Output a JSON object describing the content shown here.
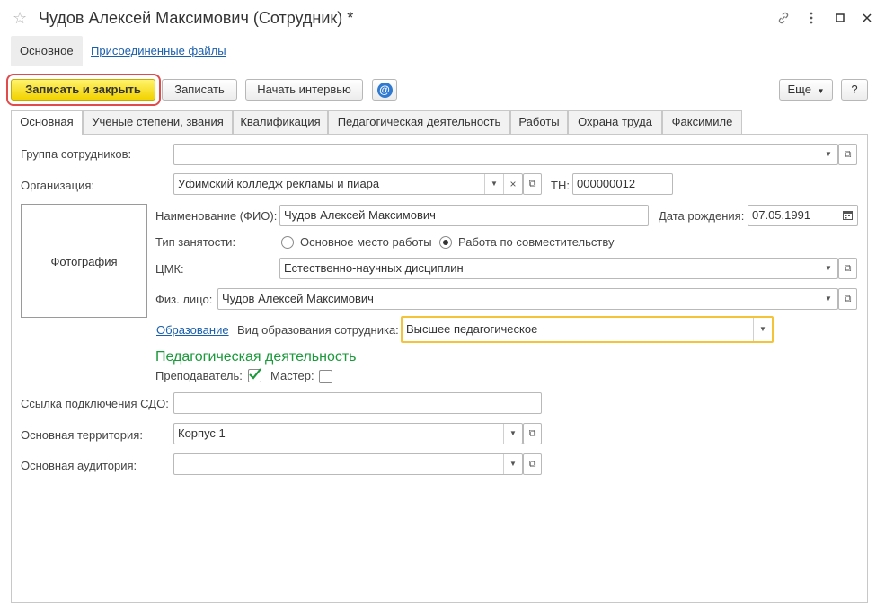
{
  "window": {
    "title": "Чудов Алексей Максимович (Сотрудник) *",
    "icons": {
      "favorite": "star-icon",
      "link": "link-icon",
      "menu": "more-vertical-icon",
      "maximize": "maximize-icon",
      "close": "close-icon"
    }
  },
  "nav": {
    "main": "Основное",
    "files": "Присоединенные файлы"
  },
  "toolbar": {
    "save_close": "Записать и закрыть",
    "save": "Записать",
    "interview": "Начать интервью",
    "mail_icon": "@",
    "more": "Еще",
    "help": "?"
  },
  "tabs": [
    "Основная",
    "Ученые степени, звания",
    "Квалификация",
    "Педагогическая деятельность",
    "Работы",
    "Охрана труда",
    "Факсимиле"
  ],
  "form": {
    "group": {
      "label": "Группа сотрудников:",
      "value": ""
    },
    "org": {
      "label": "Организация:",
      "value": "Уфимский колледж рекламы и пиара"
    },
    "tn": {
      "label": "ТН:",
      "value": "000000012"
    },
    "photo": "Фотография",
    "fio": {
      "label": "Наименование (ФИО):",
      "value": "Чудов Алексей Максимович"
    },
    "birth": {
      "label": "Дата рождения:",
      "value": "07.05.1991"
    },
    "employment": {
      "label": "Тип занятости:",
      "options": [
        "Основное место работы",
        "Работа по совместительству"
      ],
      "selected": "Работа по совместительству"
    },
    "cmk": {
      "label": "ЦМК:",
      "value": "Естественно-научных дисциплин"
    },
    "person": {
      "label": "Физ. лицо:",
      "value": "Чудов Алексей Максимович"
    },
    "education": {
      "link": "Образование",
      "label": "Вид образования сотрудника:",
      "value": "Высшее педагогическое"
    },
    "pedagogy": {
      "title": "Педагогическая деятельность",
      "teacher": {
        "label": "Преподаватель:",
        "checked": true
      },
      "master": {
        "label": "Мастер:",
        "checked": false
      }
    },
    "sdo": {
      "label": "Ссылка подключения СДО:",
      "value": ""
    },
    "territory": {
      "label": "Основная территория:",
      "value": "Корпус 1"
    },
    "auditorium": {
      "label": "Основная аудитория:",
      "value": ""
    }
  },
  "colors": {
    "accent_yellow": "#f2d200",
    "highlight_red": "#e04b4b",
    "section_green": "#1a9a3a",
    "link_blue": "#1a5fad",
    "focus_yellow": "#f4c33a"
  }
}
